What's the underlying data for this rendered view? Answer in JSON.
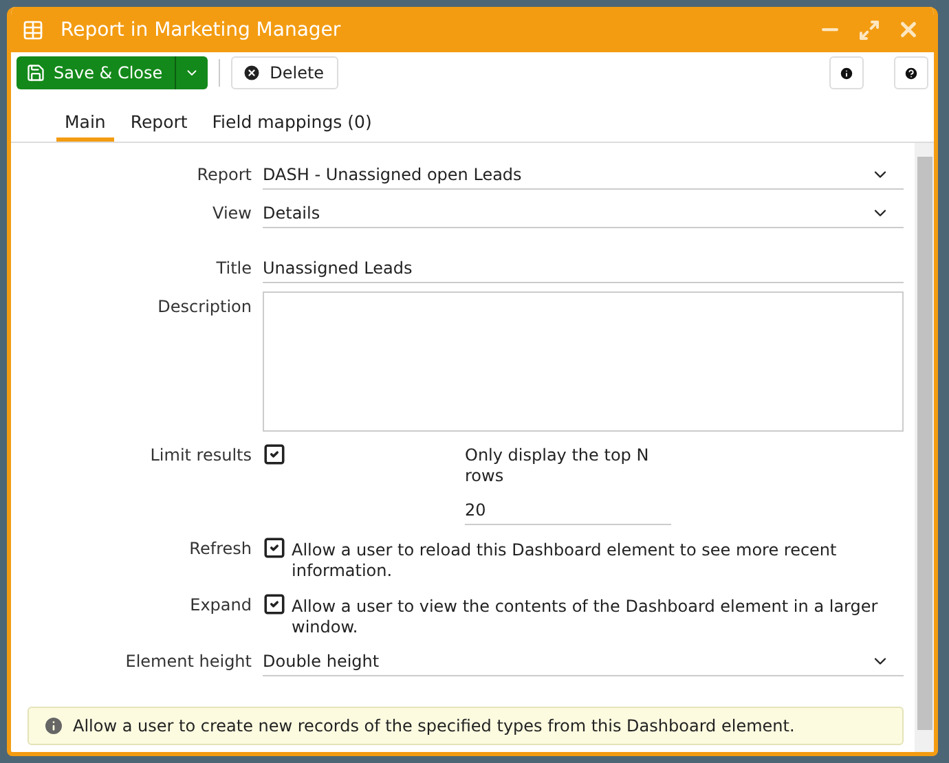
{
  "window": {
    "title": "Report in Marketing Manager"
  },
  "toolbar": {
    "save": "Save & Close",
    "delete": "Delete"
  },
  "tabs": [
    {
      "label": "Main",
      "selected": true
    },
    {
      "label": "Report",
      "selected": false
    },
    {
      "label": "Field mappings (0)",
      "selected": false
    }
  ],
  "field_groups": [
    [
      {
        "kind": "select",
        "label": "Report",
        "value": "DASH - Unassigned open Leads"
      },
      {
        "kind": "select",
        "label": "View",
        "value": "Details"
      }
    ],
    [
      {
        "kind": "text",
        "label": "Title",
        "value": "Unassigned Leads"
      },
      {
        "kind": "textarea",
        "label": "Description"
      },
      {
        "kind": "limit",
        "label": "Limit results",
        "checked": true,
        "sub_label": "Only display the top N rows",
        "value": "20"
      },
      {
        "kind": "checkbox",
        "label": "Refresh",
        "checked": true,
        "text": "Allow a user to reload this Dashboard element to see more recent information."
      },
      {
        "kind": "checkbox",
        "label": "Expand",
        "checked": true,
        "text": "Allow a user to view the contents of the Dashboard element in a larger window."
      },
      {
        "kind": "select",
        "label": "Element height",
        "value": "Double height"
      }
    ]
  ],
  "notice": "Allow a user to create new records of the specified types from this Dashboard element."
}
